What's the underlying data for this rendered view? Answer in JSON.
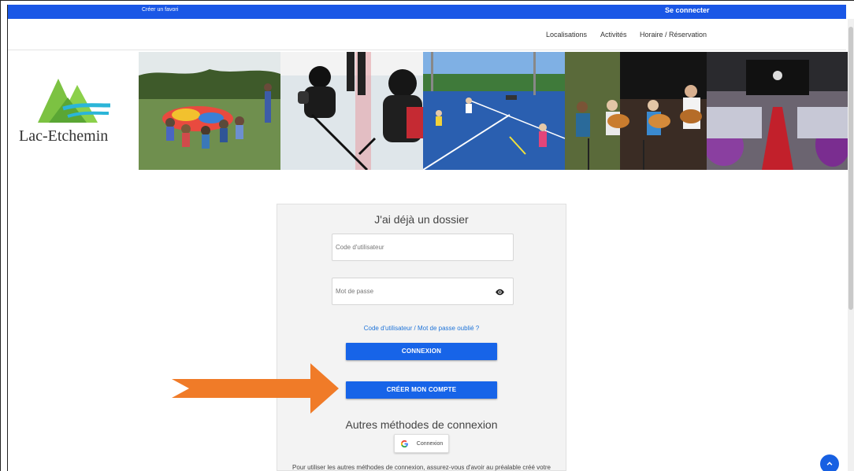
{
  "topbar": {
    "favorite_label": "Créer un favori",
    "login_label": "Se connecter",
    "color": "#1a57e6"
  },
  "nav": {
    "items": [
      {
        "label": "Localisations"
      },
      {
        "label": "Activités"
      },
      {
        "label": "Horaire / Réservation"
      }
    ]
  },
  "brand": {
    "name": "Lac-Etchemin"
  },
  "banner": {
    "photos": [
      {
        "alt": "children-group-photo"
      },
      {
        "alt": "hockey-photo"
      },
      {
        "alt": "tennis-photo"
      },
      {
        "alt": "guitar-photo"
      },
      {
        "alt": "hall-photo"
      }
    ]
  },
  "login": {
    "title": "J'ai déjà un dossier",
    "username_placeholder": "Code d'utilisateur",
    "password_placeholder": "Mot de passe",
    "forgot_link": "Code d'utilisateur / Mot de passe oublié ?",
    "connect_button": "CONNEXION",
    "create_button": "CRÉER MON COMPTE",
    "others_title": "Autres méthodes de connexion",
    "google_button": "Connexion",
    "note": "Pour utiliser les autres méthodes de connexion, assurez-vous d'avoir au préalable créé votre"
  },
  "colors": {
    "accent": "#1764e8",
    "arrow": "#f07b28",
    "link": "#1e73d8"
  },
  "icons": {
    "eye": "eye-icon",
    "google": "google-icon",
    "scroll_top": "chevron-up-icon",
    "arrow": "arrow-right-icon"
  }
}
